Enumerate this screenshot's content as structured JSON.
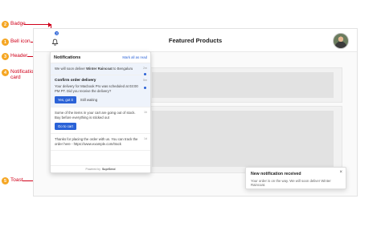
{
  "callouts": [
    {
      "num": "2",
      "label": "Badge"
    },
    {
      "num": "1",
      "label": "Bell icon"
    },
    {
      "num": "3",
      "label": "Header"
    },
    {
      "num": "4",
      "label": "Notification\ncard"
    },
    {
      "num": "5",
      "label": "Toast"
    }
  ],
  "app": {
    "title": "Featured Products",
    "badge_count": "3"
  },
  "inbox": {
    "title": "Notifications",
    "mark_all_read": "Mark all as read",
    "footer_prefix": "Powered by",
    "footer_brand": "SuprSend",
    "cards": [
      {
        "text_before": "We will soon deliver ",
        "text_bold": "Winter Raincoat",
        "text_after": " to Bengaluru",
        "time": "2m"
      },
      {
        "title": "Confirm order delivery",
        "text": "Your delivery for Macbook Pro was scheduled at 03:00 PM PT. Did you receive the delivery?",
        "time": "5m",
        "primary": "Yes, got it",
        "secondary": "Still waiting"
      },
      {
        "text": "Some of the items in your cart are going out of stock. Buy before everything is sticked out",
        "time": "1h",
        "primary": "Go to cart"
      },
      {
        "text": "Thanks for placing the order with us. You can track the order here - https://www.example.com/track",
        "time": "1d"
      }
    ]
  },
  "toast": {
    "title": "New notification received",
    "body": "Your order is on the way. We will soon deliver Winter Raincoat.",
    "close": "×"
  },
  "colors": {
    "accent": "#2a62d7",
    "callout_line": "#d0021b",
    "callout_badge": "#f5a623"
  },
  "icons": [
    "bell-icon",
    "close-icon",
    "avatar"
  ]
}
